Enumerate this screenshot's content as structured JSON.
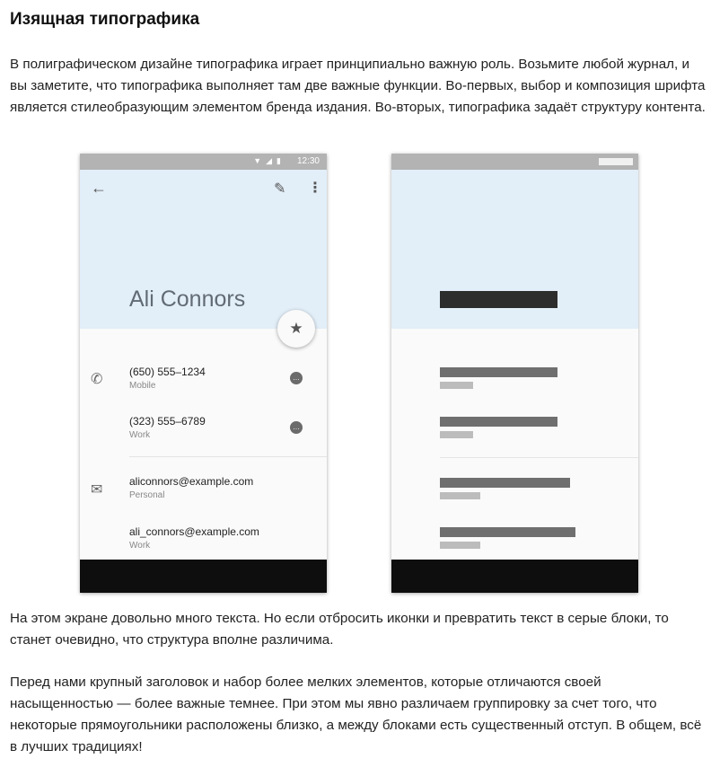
{
  "article": {
    "title": "Изящная типографика",
    "paragraph_1": "В полиграфическом дизайне типографика играет принципиально важную роль. Возьмите любой журнал, и вы заметите, что типографика выполняет там две важные функции. Во-первых, выбор и композиция шрифта является стилеобразующим элементом бренда издания. Во-вторых, типографика задаёт структуру контента.",
    "paragraph_2": "На этом экране довольно много текста. Но если отбросить иконки и превратить текст в серые блоки, то станет очевидно, что структура вполне различима.",
    "paragraph_3": "Перед нами крупный заголовок и набор более мелких элементов, которые отличаются своей насыщенностью — более важные темнее. При этом мы явно различаем группировку за счет того, что некоторые прямоугольники расположены близко, а между блоками есть существенный отступ. В общем, всё в лучших традициях!"
  },
  "phone": {
    "status_time": "12:30",
    "contact_name": "Ali Connors",
    "phones": [
      {
        "number": "(650) 555–1234",
        "type": "Mobile"
      },
      {
        "number": "(323) 555–6789",
        "type": "Work"
      }
    ],
    "emails": [
      {
        "address": "aliconnors@example.com",
        "type": "Personal"
      },
      {
        "address": "ali_connors@example.com",
        "type": "Work"
      }
    ]
  },
  "icons": {
    "back": "arrow-back-icon",
    "edit": "pencil-icon",
    "more": "more-vert-icon",
    "favorite": "star-icon",
    "phone": "phone-icon",
    "email": "mail-icon",
    "message": "chat-bubble-icon"
  },
  "colors": {
    "header_bg": "#e2eef8",
    "status_bar": "#b3b3b3",
    "nav_bar": "#0e0e0e"
  }
}
